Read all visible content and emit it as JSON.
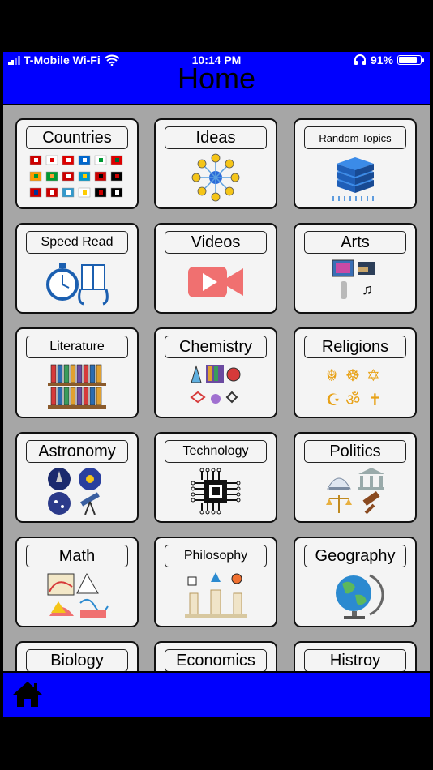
{
  "status": {
    "carrier": "T-Mobile Wi-Fi",
    "time": "10:14 PM",
    "battery": "91%",
    "battery_level": 0.91
  },
  "header": {
    "title": "Home"
  },
  "topics": [
    {
      "label": "Countries",
      "icon": "flags-icon"
    },
    {
      "label": "Ideas",
      "icon": "lightbulb-network-icon"
    },
    {
      "label": "Random Topics",
      "icon": "server-stack-icon"
    },
    {
      "label": "Speed Read",
      "icon": "stopwatch-book-icon"
    },
    {
      "label": "Videos",
      "icon": "video-camera-icon"
    },
    {
      "label": "Arts",
      "icon": "arts-collage-icon"
    },
    {
      "label": "Literature",
      "icon": "bookshelf-icon"
    },
    {
      "label": "Chemistry",
      "icon": "chemistry-lab-icon"
    },
    {
      "label": "Religions",
      "icon": "religious-symbols-icon"
    },
    {
      "label": "Astronomy",
      "icon": "astronomy-collage-icon"
    },
    {
      "label": "Technology",
      "icon": "microchip-icon"
    },
    {
      "label": "Politics",
      "icon": "government-justice-icon"
    },
    {
      "label": "Math",
      "icon": "math-geometry-icon"
    },
    {
      "label": "Philosophy",
      "icon": "philosophy-pillars-icon"
    },
    {
      "label": "Geography",
      "icon": "globe-icon"
    },
    {
      "label": "Biology",
      "icon": "biology-icon"
    },
    {
      "label": "Economics",
      "icon": "economics-icon"
    },
    {
      "label": "Histroy",
      "icon": "history-icon"
    }
  ],
  "nav": {
    "home_icon": "home-icon"
  },
  "colors": {
    "bar_blue": "#0000fe",
    "panel_gray": "#a6a6a6",
    "card_bg": "#f4f4f4"
  }
}
